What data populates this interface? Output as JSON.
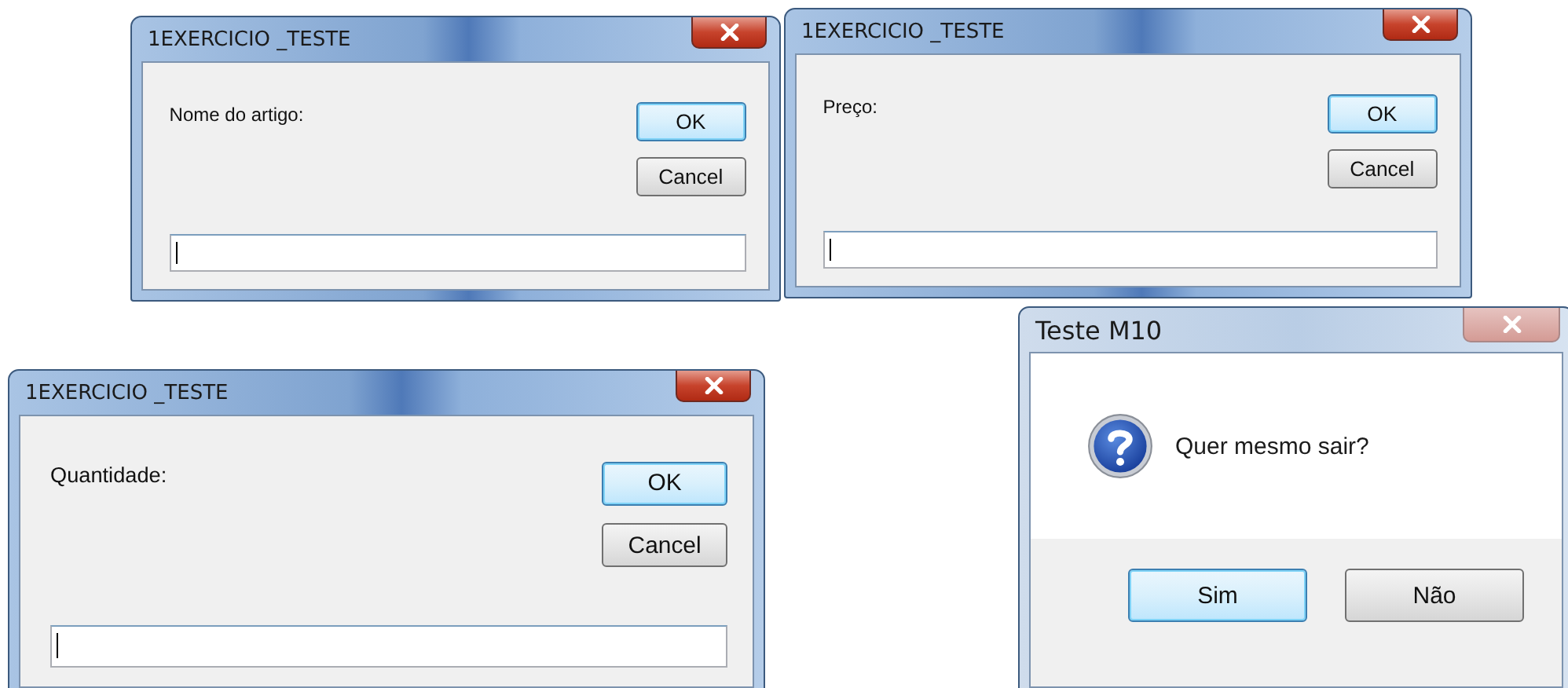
{
  "windows": [
    {
      "kind": "input",
      "title": "1EXERCICIO _TESTE",
      "active": true,
      "prompt": "Nome do artigo:",
      "buttons": [
        {
          "label": "OK",
          "default": true
        },
        {
          "label": "Cancel",
          "default": false
        }
      ]
    },
    {
      "kind": "input",
      "title": "1EXERCICIO _TESTE",
      "active": true,
      "prompt": "Preço:",
      "buttons": [
        {
          "label": "OK",
          "default": true
        },
        {
          "label": "Cancel",
          "default": false
        }
      ]
    },
    {
      "kind": "input",
      "title": "1EXERCICIO _TESTE",
      "active": true,
      "prompt": "Quantidade:",
      "buttons": [
        {
          "label": "OK",
          "default": true
        },
        {
          "label": "Cancel",
          "default": false
        }
      ]
    },
    {
      "kind": "message",
      "title": "Teste M10",
      "active": false,
      "message": "Quer mesmo sair?",
      "buttons": [
        {
          "label": "Sim",
          "default": true
        },
        {
          "label": "Não",
          "default": false
        }
      ]
    }
  ]
}
